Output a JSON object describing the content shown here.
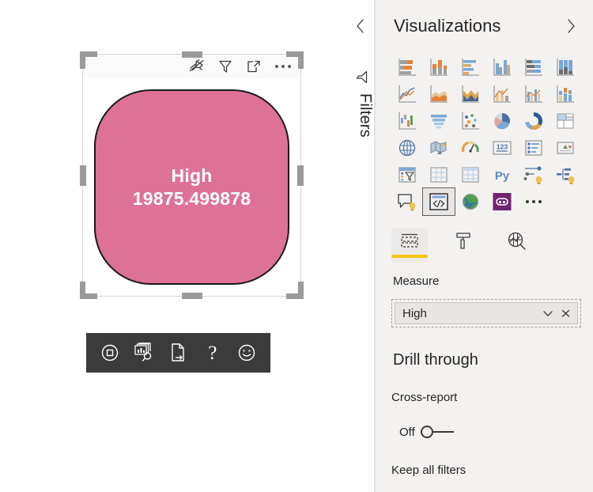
{
  "canvas": {
    "visual": {
      "header_buttons": [
        {
          "name": "pin-visual-icon",
          "label": "Pin visual"
        },
        {
          "name": "filter-icon",
          "label": "Filters applied"
        },
        {
          "name": "focus-mode-icon",
          "label": "Focus mode"
        },
        {
          "name": "more-options-icon",
          "label": "More options"
        }
      ],
      "card_title": "High",
      "card_value": "19875.499878",
      "shape_fill": "#DE7196",
      "shape_stroke": "#1A1A1A",
      "text_color": "#FFFFFF"
    },
    "toolbar": {
      "background": "#3B3B3B",
      "buttons": [
        {
          "name": "record-icon",
          "label": "Record"
        },
        {
          "name": "insights-icon",
          "label": "Get insights"
        },
        {
          "name": "export-page-icon",
          "label": "Export page"
        },
        {
          "name": "help-icon",
          "label": "?"
        },
        {
          "name": "feedback-smiley-icon",
          "label": "Send feedback"
        }
      ],
      "help_glyph": "?"
    }
  },
  "filters_pane": {
    "label": "Filters",
    "icon": "filter-funnel-icon",
    "collapsed": true
  },
  "visualizations": {
    "title": "Visualizations",
    "collapse_icon": "chevron-left-icon",
    "expand_icon": "chevron-right-icon",
    "gallery": [
      {
        "name": "stacked-bar-chart",
        "label": "Stacked bar chart"
      },
      {
        "name": "stacked-column-chart",
        "label": "Stacked column chart"
      },
      {
        "name": "clustered-bar-chart",
        "label": "Clustered bar chart"
      },
      {
        "name": "clustered-column-chart",
        "label": "Clustered column chart"
      },
      {
        "name": "hundred-percent-stacked-bar-chart",
        "label": "100% stacked bar chart"
      },
      {
        "name": "hundred-percent-stacked-column-chart",
        "label": "100% stacked column chart"
      },
      {
        "name": "line-chart",
        "label": "Line chart"
      },
      {
        "name": "area-chart",
        "label": "Area chart"
      },
      {
        "name": "stacked-area-chart",
        "label": "Stacked area chart"
      },
      {
        "name": "line-and-stacked-column-chart",
        "label": "Line and stacked column chart"
      },
      {
        "name": "line-and-clustered-column-chart",
        "label": "Line and clustered column chart"
      },
      {
        "name": "ribbon-chart",
        "label": "Ribbon chart"
      },
      {
        "name": "waterfall-chart",
        "label": "Waterfall chart"
      },
      {
        "name": "funnel-chart",
        "label": "Funnel"
      },
      {
        "name": "scatter-chart",
        "label": "Scatter chart"
      },
      {
        "name": "pie-chart",
        "label": "Pie chart"
      },
      {
        "name": "donut-chart",
        "label": "Donut chart"
      },
      {
        "name": "treemap",
        "label": "Treemap"
      },
      {
        "name": "map",
        "label": "Map"
      },
      {
        "name": "filled-map",
        "label": "Filled map"
      },
      {
        "name": "gauge",
        "label": "Gauge"
      },
      {
        "name": "card",
        "label": "Card"
      },
      {
        "name": "multi-row-card",
        "label": "Multi-row card"
      },
      {
        "name": "kpi",
        "label": "KPI"
      },
      {
        "name": "slicer",
        "label": "Slicer"
      },
      {
        "name": "table",
        "label": "Table"
      },
      {
        "name": "matrix",
        "label": "Matrix"
      },
      {
        "name": "python-visual",
        "label": "Py"
      },
      {
        "name": "key-influencers",
        "label": "Key influencers"
      },
      {
        "name": "decomposition-tree",
        "label": "Decomposition tree"
      },
      {
        "name": "qanda-visual",
        "label": "Q&A"
      },
      {
        "name": "code-visual",
        "label": "R script visual",
        "selected": true
      },
      {
        "name": "arcgis-maps",
        "label": "ArcGIS Maps for Power BI"
      },
      {
        "name": "custom-visual",
        "label": "Custom visual"
      },
      {
        "name": "more-visuals",
        "label": "More options"
      }
    ],
    "python_glyph": "Py",
    "card_glyph": "123",
    "tabs": [
      {
        "name": "tab-fields",
        "label": "Fields",
        "icon": "fields-icon",
        "active": true
      },
      {
        "name": "tab-format",
        "label": "Format",
        "icon": "paint-roller-icon",
        "active": false
      },
      {
        "name": "tab-analytics",
        "label": "Analytics",
        "icon": "analytics-magnifier-icon",
        "active": false
      }
    ],
    "field_well": {
      "section_label": "Measure",
      "chip_value": "High",
      "dropdown_icon": "chevron-down-icon",
      "remove_icon": "close-icon"
    },
    "drill_through": {
      "title": "Drill through",
      "cross_report_label": "Cross-report",
      "toggle_state": "Off",
      "keep_all_filters_label": "Keep all filters"
    }
  },
  "colors": {
    "pane_background": "#F3F2F1",
    "canvas_background": "#FFFFFF",
    "accent_yellow": "#F2C811",
    "toolbar_dark": "#3B3B3B",
    "custom_visual_purple": "#702670"
  }
}
